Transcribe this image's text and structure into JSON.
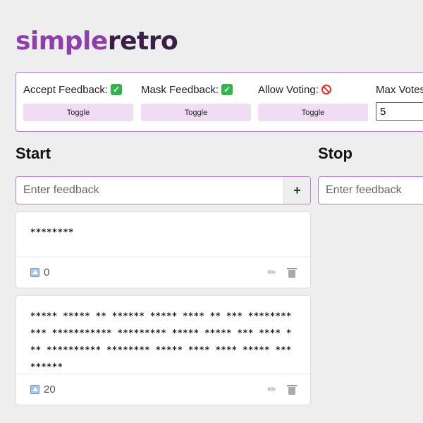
{
  "logo": {
    "part1": "simple",
    "part2": "retro"
  },
  "controls": {
    "accept_feedback": {
      "label": "Accept Feedback:",
      "state": "enabled",
      "toggle_label": "Toggle"
    },
    "mask_feedback": {
      "label": "Mask Feedback:",
      "state": "enabled",
      "toggle_label": "Toggle"
    },
    "allow_voting": {
      "label": "Allow Voting:",
      "state": "disabled",
      "toggle_label": "Toggle"
    },
    "max_votes": {
      "label": "Max Votes",
      "value": "5"
    }
  },
  "columns": [
    {
      "title": "Start",
      "input_placeholder": "Enter feedback",
      "add_label": "+",
      "cards": [
        {
          "text": "********",
          "votes": "0"
        },
        {
          "text": "***** ***** ** ****** ***** **** ** *** ******** *** *********** ********* ***** ***** *** **** *** ********** ******** ***** **** **** ***** *** ******",
          "votes": "20"
        }
      ]
    },
    {
      "title": "Stop",
      "input_placeholder": "Enter feedback",
      "cards": []
    }
  ]
}
